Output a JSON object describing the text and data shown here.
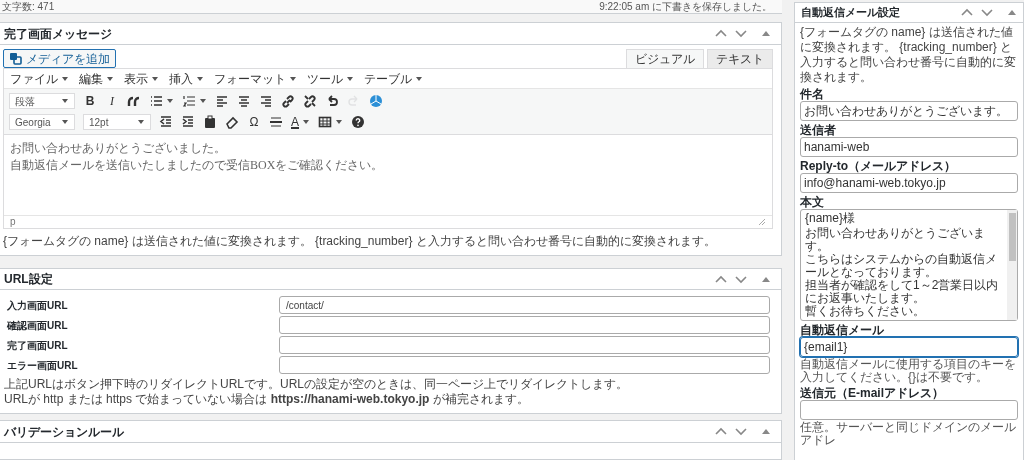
{
  "status_strip": {
    "word_count": "文字数: 471",
    "saved": "9:22:05 am に下書きを保存しました。"
  },
  "message_panel": {
    "title": "完了画面メッセージ",
    "media_button": "メディアを追加",
    "tabs": [
      {
        "label": "ビジュアル",
        "selected": true
      },
      {
        "label": "テキスト",
        "selected": false
      }
    ],
    "menus": [
      "ファイル",
      "編集",
      "表示",
      "挿入",
      "フォーマット",
      "ツール",
      "テーブル"
    ],
    "toolbar_rows": [
      [
        {
          "kind": "select",
          "value": "段落"
        },
        {
          "kind": "glyph",
          "text": "B",
          "disabled": false
        },
        {
          "kind": "glyph",
          "text": "I",
          "disabled": false
        },
        {
          "kind": "icon",
          "disabled": false
        },
        {
          "kind": "icon",
          "disabled": false
        },
        {
          "kind": "icon",
          "disabled": false
        },
        {
          "kind": "icon",
          "disabled": false
        },
        {
          "kind": "icon",
          "disabled": false
        },
        {
          "kind": "icon",
          "disabled": false
        },
        {
          "kind": "icon",
          "disabled": false
        },
        {
          "kind": "icon",
          "disabled": false
        },
        {
          "kind": "icon",
          "disabled": false
        },
        {
          "kind": "icon",
          "disabled": true
        },
        {
          "kind": "icon",
          "disabled": false
        }
      ],
      [
        {
          "kind": "select",
          "value": "Georgia"
        },
        {
          "kind": "select",
          "value": "12pt"
        },
        {
          "kind": "icon",
          "disabled": false
        },
        {
          "kind": "icon",
          "disabled": false
        },
        {
          "kind": "icon",
          "disabled": false
        },
        {
          "kind": "icon",
          "disabled": false
        },
        {
          "kind": "glyph",
          "text": "Ω",
          "disabled": false
        },
        {
          "kind": "icon",
          "disabled": false
        },
        {
          "kind": "glyph",
          "text": "A",
          "disabled": false
        },
        {
          "kind": "icon",
          "disabled": false
        },
        {
          "kind": "icon",
          "disabled": false
        }
      ]
    ],
    "content": [
      "お問い合わせありがとうございました。",
      "自動返信メールを送信いたしましたので受信BOXをご確認ください。"
    ],
    "path": "p",
    "note": "{フォームタグの name} は送信された値に変換されます。 {tracking_number} と入力すると問い合わせ番号に自動的に変換されます。"
  },
  "url_panel": {
    "title": "URL設定",
    "rows": [
      {
        "label": "入力画面URL",
        "value": "/contact/"
      },
      {
        "label": "確認画面URL"
      },
      {
        "label": "完了画面URL"
      },
      {
        "label": "エラー画面URL"
      }
    ],
    "notes": [
      "上記URLはボタン押下時のリダイレクトURLです。URLの設定が空のときは、同一ページ上でリダイレクトします。",
      "URLが http または https で始まっていない場合は **https://hanami-web.tokyo.jp** が補完されます。"
    ]
  },
  "validation_panel": {
    "title": "バリデーションルール"
  },
  "sidebar": {
    "title": "自動返信メール設定",
    "note": "{フォームタグの name} は送信された値に変換されます。 {tracking_number} と入力すると問い合わせ番号に自動的に変換されます。",
    "fields": [
      {
        "kind": "input",
        "label": "件名",
        "value": "お問い合わせありがとうございます。",
        "focused": false
      },
      {
        "kind": "input",
        "label": "送信者",
        "value": "hanami-web",
        "focused": false
      },
      {
        "kind": "input",
        "label": "Reply-to（メールアドレス）",
        "value": "info@hanami-web.tokyo.jp",
        "focused": false
      },
      {
        "kind": "textarea",
        "label": "本文",
        "lines": [
          "{name}様",
          "お問い合わせありがとうございます。",
          "こちらはシステムからの自動返信メールとなっております。",
          "担当者が確認をして1～2営業日以内にお返事いたします。",
          "暫くお待ちください。"
        ],
        "focused": false
      },
      {
        "kind": "input",
        "label": "自動返信メール",
        "value": "{email1}",
        "focused": true,
        "hint": "自動返信メールに使用する項目のキーを入力してください。{}は不要です。"
      },
      {
        "kind": "input",
        "label": "送信元（E-mailアドレス）",
        "focused": false,
        "hint": "任意。サーバーと同じドメインのメールアドレ"
      }
    ]
  }
}
